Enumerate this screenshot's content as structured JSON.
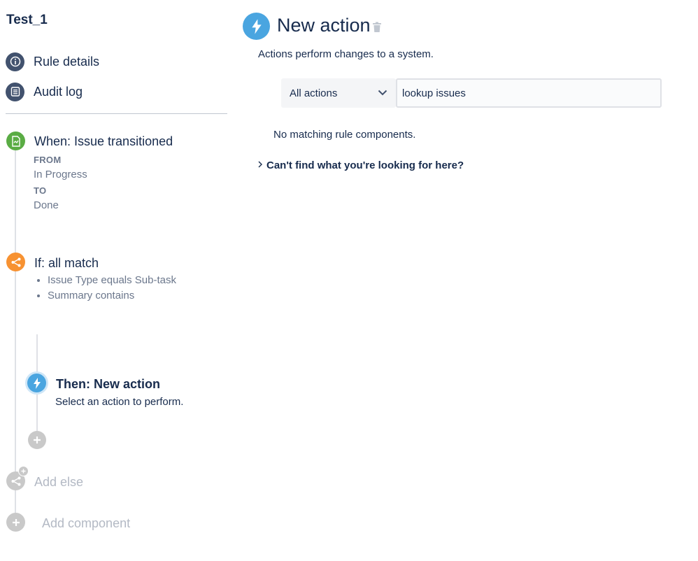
{
  "rule": {
    "name": "Test_1"
  },
  "sidebar": {
    "nav": [
      {
        "label": "Rule details",
        "icon": "info-icon"
      },
      {
        "label": "Audit log",
        "icon": "list-icon"
      }
    ]
  },
  "flow": {
    "trigger": {
      "title": "When: Issue transitioned",
      "from_label": "FROM",
      "from_value": "In Progress",
      "to_label": "TO",
      "to_value": "Done",
      "icon": "trigger-icon",
      "color": "#5aac44"
    },
    "condition": {
      "title": "If: all match",
      "items": [
        "Issue Type equals Sub-task",
        "Summary contains"
      ],
      "icon": "branch-icon",
      "color": "#f79232"
    },
    "action": {
      "title": "Then: New action",
      "description": "Select an action to perform.",
      "icon": "lightning-icon",
      "color": "#4aa5e0"
    },
    "add_else_label": "Add else",
    "add_component_label": "Add component"
  },
  "main": {
    "title": "New action",
    "description": "Actions perform changes to a system.",
    "filter_select": {
      "value": "All actions"
    },
    "search": {
      "value": "lookup issues",
      "placeholder": ""
    },
    "empty_message": "No matching rule components.",
    "help_toggle": "Can't find what you're looking for here?"
  }
}
